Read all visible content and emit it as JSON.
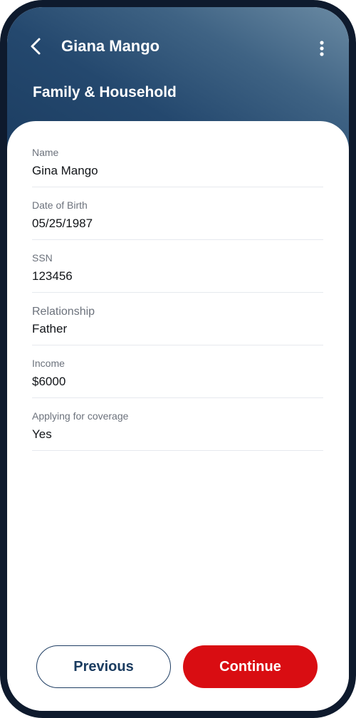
{
  "header": {
    "title": "Giana Mango",
    "section_title": "Family & Household",
    "back_icon": "chevron-left-icon",
    "menu_icon": "more-vertical-icon"
  },
  "fields": [
    {
      "label": "Name",
      "value": "Gina Mango"
    },
    {
      "label": "Date of Birth",
      "value": "05/25/1987"
    },
    {
      "label": "SSN",
      "value": "123456"
    },
    {
      "label": "Relationship",
      "value": "Father"
    },
    {
      "label": "Income",
      "value": "$6000"
    },
    {
      "label": "Applying for coverage",
      "value": "Yes"
    }
  ],
  "actions": {
    "previous_label": "Previous",
    "continue_label": "Continue"
  },
  "colors": {
    "header_dark": "#1b3c60",
    "accent_red": "#d90d12"
  }
}
